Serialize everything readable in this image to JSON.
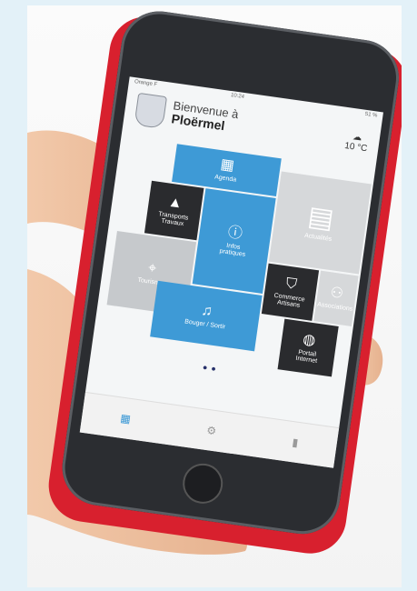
{
  "app": {
    "status_left": "Orange F",
    "status_time": "10:24",
    "status_right": "51 %",
    "welcome_line1": "Bienvenue à",
    "welcome_line2": "Ploërmel",
    "temperature": "10 °C"
  },
  "tiles": {
    "agenda": "Agenda",
    "transports": "Transports",
    "travaux": "Travaux",
    "actualites": "Actualités",
    "infos": "Infos",
    "pratiques": "pratiques",
    "tourisme": "Tourisme",
    "commerce": "Commerce",
    "artisans": "Artisans",
    "associations": "Associations",
    "bouger": "Bouger / Sortir",
    "portail": "Portail",
    "internet": "Internet"
  },
  "icons": {
    "agenda": "calendar-icon",
    "transports": "road-icon",
    "actualites": "document-icon",
    "infos": "info-icon",
    "tourisme": "map-icon",
    "commerce": "bag-icon",
    "associations": "people-icon",
    "bouger": "music-icon",
    "portail": "globe-icon",
    "weather": "cloud-icon"
  },
  "colors": {
    "tile_blue": "#3e9ad6",
    "tile_dark": "#2a2b2e",
    "case_red": "#d8202e",
    "page_bg": "#e3f1f8"
  }
}
